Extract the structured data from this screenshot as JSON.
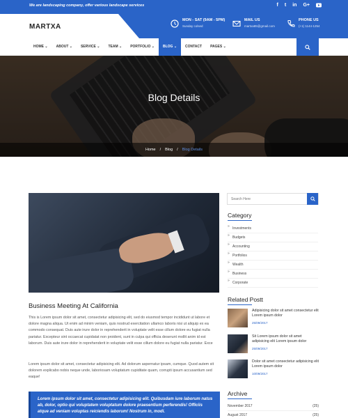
{
  "topbar": {
    "tagline": "We are landscaping company, offer various landscape services",
    "socials": [
      "f",
      "t",
      "in",
      "G+",
      "yt"
    ]
  },
  "header": {
    "logo": "MARTXA",
    "info": [
      {
        "icon": "clock-icon",
        "title": "MON - SAT (9AM - 5PM)",
        "sub": "Sunday colsed"
      },
      {
        "icon": "mail-icon",
        "title": "MAIL US",
        "sub": "martxa85@gmail.com"
      },
      {
        "icon": "phone-icon",
        "title": "PHONE US",
        "sub": "(+1) 1144-1254"
      }
    ]
  },
  "nav": {
    "items": [
      "HOME",
      "ABOUT",
      "SERVICE",
      "TEAM",
      "PORTFOLIO",
      "BLOG",
      "CONTACT",
      "PAGES"
    ],
    "dropdown": [
      true,
      true,
      true,
      true,
      true,
      true,
      false,
      true
    ],
    "active": "BLOG"
  },
  "hero": {
    "title": "Blog Details",
    "breadcrumb": [
      "Home",
      "Blog",
      "Blog Details"
    ]
  },
  "post": {
    "title": "Business Meeting At California",
    "p1": "This is Lorem ipsum dolor sit amet, consectetur adipisicing elit, sed do eiusmod tempor incididunt ut labore et dolore magna aliqua. Ut enim ad minim veniam, quis nostrud exercitation ullamco laboris nisi ut aliquip ex ea commodo consequat. Duis aute irure dolor in reprehenderit in voluptate velit esse cillum dolore eu fugiat nulla pariatur. Excepteur sint occaecat cupidatat non proident, sunt in culpa qui officia deserunt mollit anim id est laborum. Duis aute irure dolor in reprehenderit in voluptate velit esse cillum dolore eu fugiat nulla pariatur. Exce",
    "p2": "Lorem ipsum dolor sit amet, consectetur adipisicing elit. Ad dolorum aspernatur ipsam, cumque. Quod autem sit dolorem explicabo nobis neque unde, laboriosam voluptatum cupiditate quam, corrupti ipsum accusantium sed eaque!",
    "quote": "Lorem ipsum dolor sit amet, consectetur adipisicing elit. Quibusdam iure laborum natus ab, dolor, optio qui voluptatem voluptatum dolore praesentium perferendis! Officiis atque ad veniam voluptas reiciendis laborum! Nostrum in, modi."
  },
  "sidebar": {
    "search_placeholder": "Search Here",
    "category_title": "Category",
    "categories": [
      "Investments",
      "Budgets",
      "Accounting",
      "Portfolios",
      "Wealth",
      "Business",
      "Corporate"
    ],
    "related_title": "Related Postt",
    "related": [
      {
        "text": "Adipisicing dolor sit amet consectetur elit Lorem ipsum dolor",
        "date": "25/09/2017"
      },
      {
        "text": "Sit Lorem ipsum dolor sit amet adipisicing elit Lorem ipsum dolor",
        "date": "25/09/2017"
      },
      {
        "text": "Dolor sit amet consectetur adipisicing elit Lorem ipsum dolor",
        "date": "10/09/2017"
      }
    ],
    "archive_title": "Archive",
    "archives": [
      {
        "month": "November 2017",
        "count": "(25)"
      },
      {
        "month": "August 2017",
        "count": "(25)"
      }
    ]
  },
  "colors": {
    "accent": "#2a64c8"
  }
}
